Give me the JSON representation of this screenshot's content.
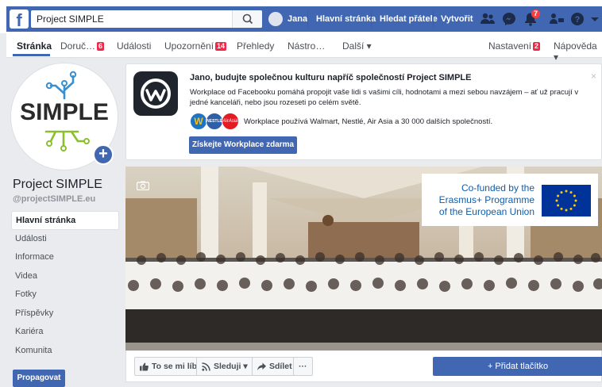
{
  "topbar": {
    "search_value": "Project SIMPLE",
    "user_name": "Jana",
    "home": "Hlavní stránka",
    "find_friends": "Hledat přátele",
    "create": "Vytvořit",
    "notifications_count": "7"
  },
  "tabs": {
    "page": "Stránka",
    "inbox": "Doruč…",
    "inbox_count": "6",
    "events": "Události",
    "notifications": "Upozornění",
    "notifications_count": "14",
    "insights": "Přehledy",
    "tools": "Nástro…",
    "more": "Další ▾",
    "settings": "Nastavení",
    "settings_count": "2",
    "help": "Nápověda ▾"
  },
  "profile": {
    "logo_text": "SIMPLE",
    "name": "Project SIMPLE",
    "handle": "@projectSIMPLE.eu"
  },
  "left_nav": [
    "Hlavní stránka",
    "Události",
    "Informace",
    "Videa",
    "Fotky",
    "Příspěvky",
    "Kariéra",
    "Komunita"
  ],
  "promote": "Propagovat",
  "ad": {
    "title": "Jano, budujte společnou kulturu napříč společností Project SIMPLE",
    "body": "Workplace od Facebooku pomáhá propojit vaše lidi s vašimi cíli, hodnotami a mezi sebou navzájem – ať už pracují v jedné kanceláři, nebo jsou rozeseti po celém světě.",
    "logos_text": "Workplace používá Walmart, Nestlé, Air Asia a 30 000 dalších společností.",
    "cta": "Získejte Workplace zdarma",
    "close": "×",
    "logo_walmart": "W",
    "logo_nestle": "NESTLÉ",
    "logo_airasia": "AirAsia"
  },
  "cover": {
    "erasmus_text": "Co-funded by the Erasmus+ Programme of the European Union"
  },
  "actions": {
    "like": "To se mi líbí",
    "follow": "Sleduji ▾",
    "share": "Sdílet",
    "more": "···",
    "add_button": "+ Přidat tlačítko"
  },
  "colors": {
    "brand": "#4267b2",
    "badge": "#fa3e3e",
    "background": "#e9ebee",
    "erasmus_blue": "#0e5eab"
  }
}
